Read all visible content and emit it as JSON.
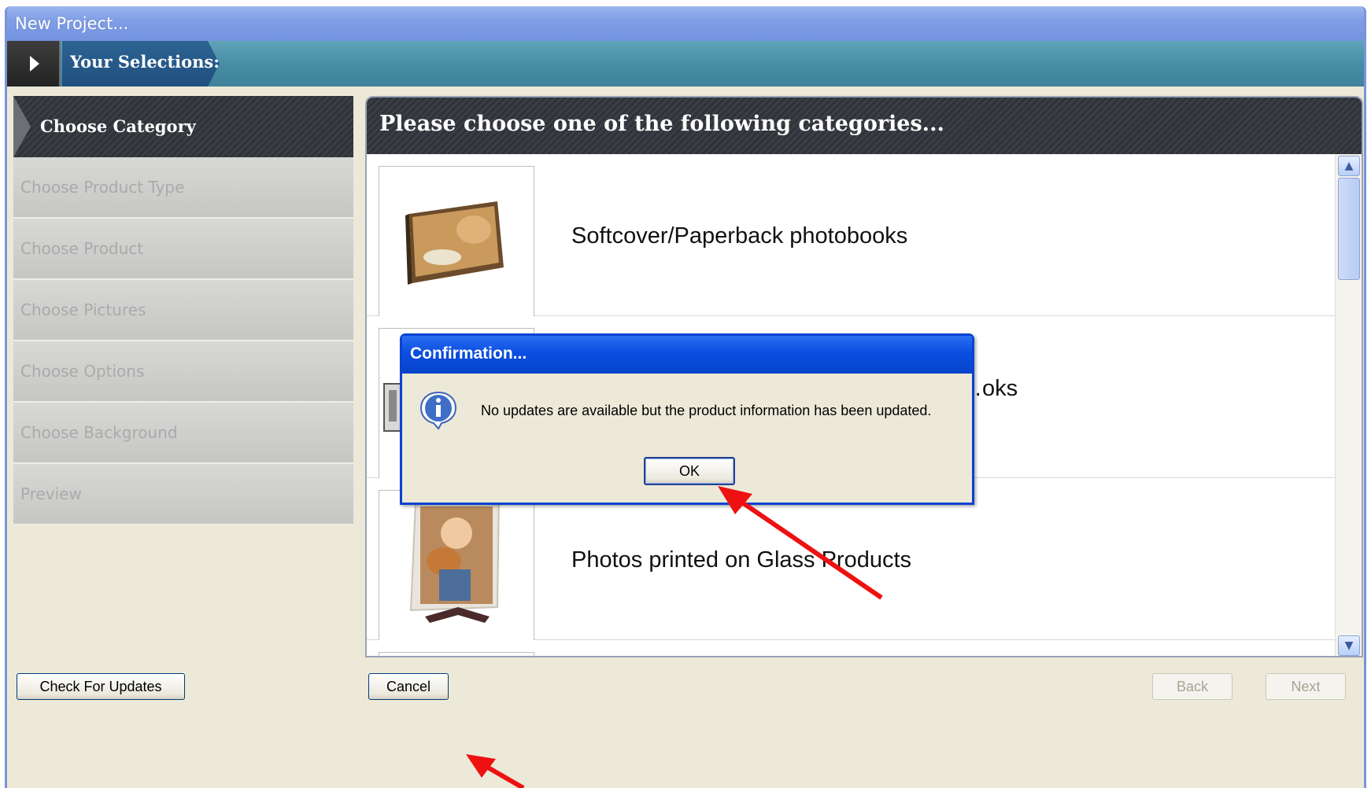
{
  "window": {
    "title": "New Project..."
  },
  "selections_bar": {
    "label": "Your Selections:"
  },
  "steps": [
    {
      "label": "Choose Category",
      "active": true
    },
    {
      "label": "Choose Product Type",
      "active": false
    },
    {
      "label": "Choose Product",
      "active": false
    },
    {
      "label": "Choose Pictures",
      "active": false
    },
    {
      "label": "Choose Options",
      "active": false
    },
    {
      "label": "Choose Background",
      "active": false
    },
    {
      "label": "Preview",
      "active": false
    }
  ],
  "main": {
    "heading": "Please choose one of the following categories...",
    "categories": [
      {
        "label": "Softcover/Paperback photobooks",
        "icon": "photobook-thumbnail"
      },
      {
        "label": "…oks",
        "icon": "photobook-thumbnail"
      },
      {
        "label": "Photos printed on Glass Products",
        "icon": "glass-photo-thumbnail"
      }
    ]
  },
  "footer": {
    "check_updates_label": "Check For Updates",
    "cancel_label": "Cancel",
    "back_label": "Back",
    "next_label": "Next"
  },
  "dialog": {
    "title": "Confirmation...",
    "message": "No updates are available but the product information has been updated.",
    "ok_label": "OK",
    "icon": "info-icon"
  },
  "colors": {
    "titlebar": "#7f9ee6",
    "selections_bar": "#4a8ea6",
    "dialog_titlebar": "#0a4ee0",
    "annotation_arrow": "#ee1111"
  }
}
